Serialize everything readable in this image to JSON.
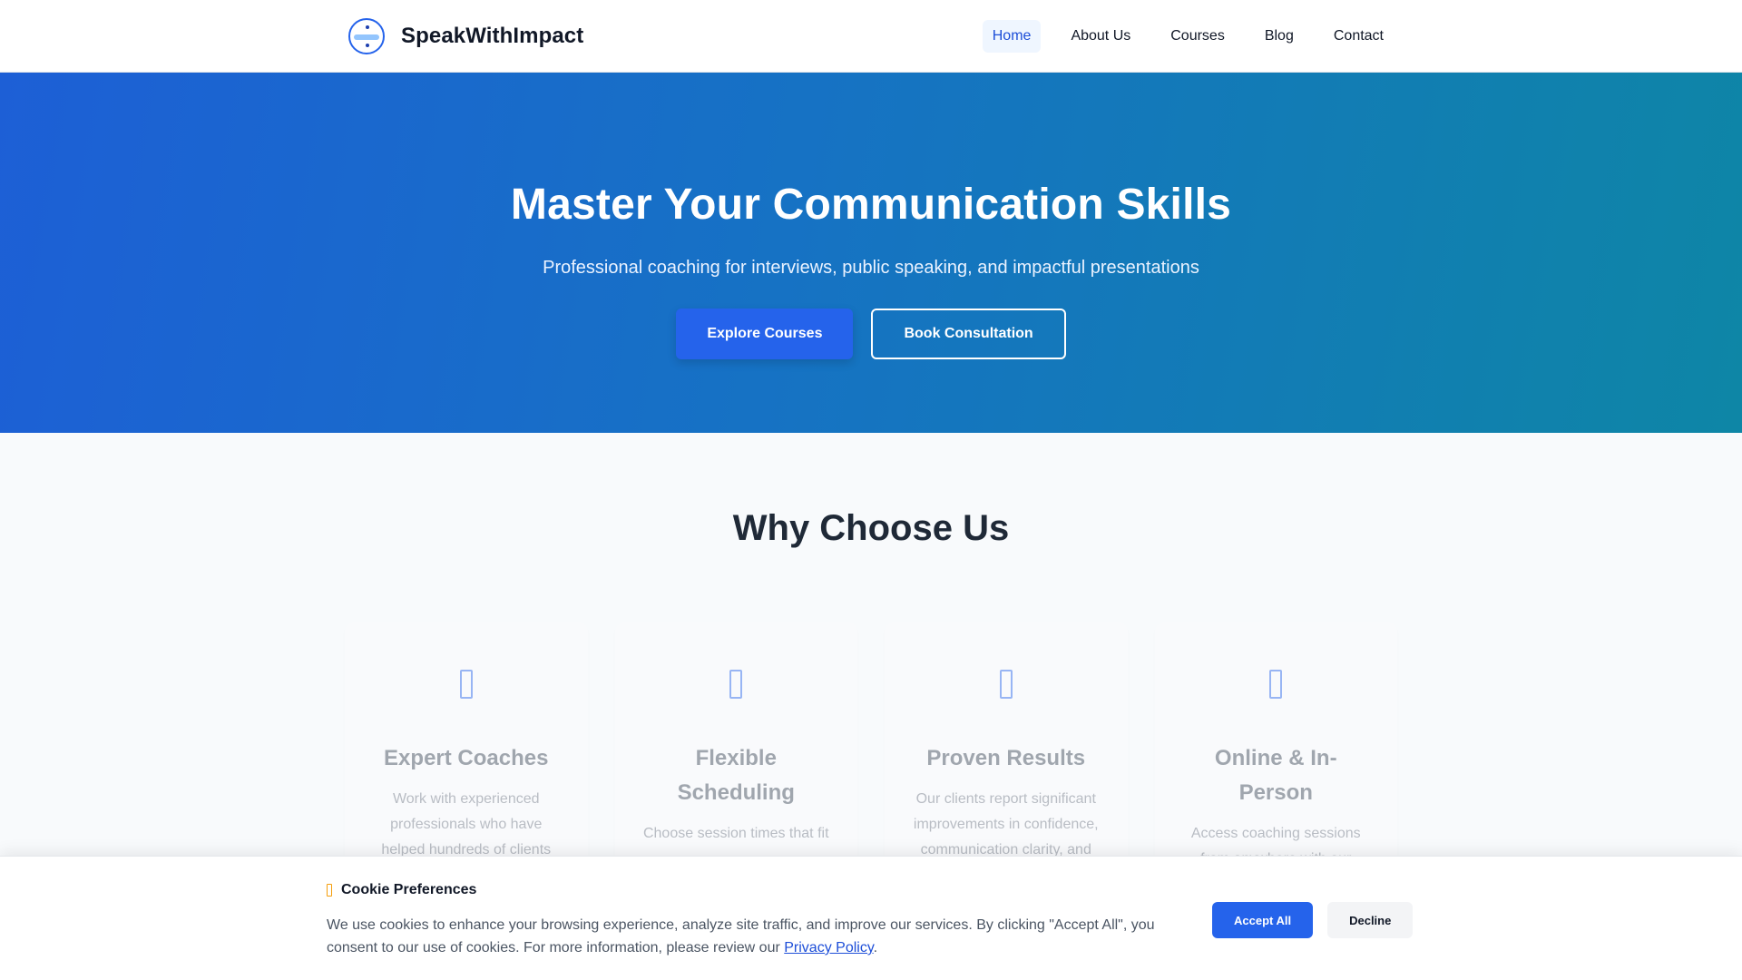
{
  "nav": {
    "brand": "SpeakWithImpact",
    "logo_icon": "circle-logo-icon",
    "links": [
      {
        "label": "Home",
        "active": true
      },
      {
        "label": "About Us",
        "active": false
      },
      {
        "label": "Courses",
        "active": false
      },
      {
        "label": "Blog",
        "active": false
      },
      {
        "label": "Contact",
        "active": false
      }
    ]
  },
  "hero": {
    "title": "Master Your Communication Skills",
    "subtitle": "Professional coaching for interviews, public speaking, and impactful presentations",
    "primary_button": "Explore Courses",
    "secondary_button": "Book Consultation"
  },
  "why": {
    "title": "Why Choose Us",
    "cards": [
      {
        "title": "Expert Coaches",
        "text": "Work with experienced professionals who have helped hundreds of clients",
        "icon": "coach-icon"
      },
      {
        "title": "Flexible Scheduling",
        "text": "Choose session times that fit",
        "icon": "calendar-icon"
      },
      {
        "title": "Proven Results",
        "text": "Our clients report significant improvements in confidence, communication clarity, and",
        "icon": "chart-icon"
      },
      {
        "title": "Online & In-Person",
        "text": "Access coaching sessions from anywhere with our virtual platform or visit our",
        "icon": "globe-icon"
      }
    ]
  },
  "cookie": {
    "icon": "cookie-icon",
    "title": "Cookie Preferences",
    "text": "We use cookies to enhance your browsing experience, analyze site traffic, and improve our services. By clicking \"Accept All\", you consent to our use of cookies. For more information, please review our",
    "link": "Privacy Policy",
    "period": ".",
    "accept": "Accept All",
    "decline": "Decline"
  },
  "colors": {
    "primary": "#2563eb",
    "hero_start": "#1d5fd6",
    "hero_end": "#0e86a6"
  }
}
